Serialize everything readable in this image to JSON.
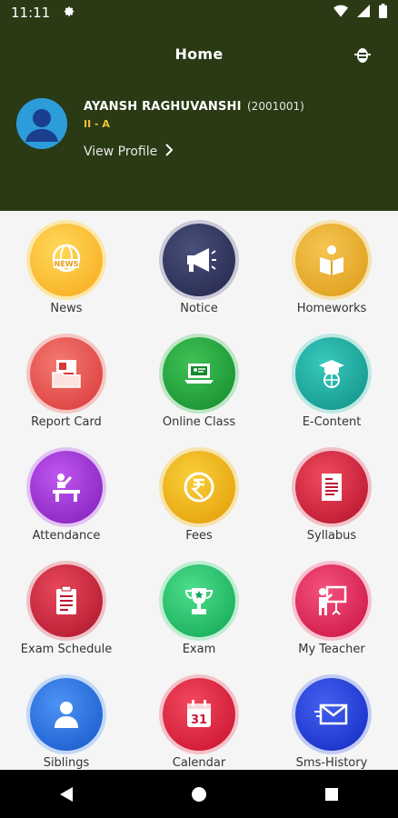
{
  "status_bar": {
    "time": "11:11"
  },
  "header": {
    "title": "Home",
    "student": {
      "name": "AYANSH RAGHUVANSHI",
      "id": "(2001001)",
      "class": "II - A",
      "view_profile": "View Profile"
    }
  },
  "menu": {
    "items": [
      {
        "label": "News",
        "icon": "news-globe-icon",
        "color": "#f7b21b"
      },
      {
        "label": "Notice",
        "icon": "megaphone-icon",
        "color": "#2a2e55"
      },
      {
        "label": "Homeworks",
        "icon": "reading-person-icon",
        "color": "#e6a419"
      },
      {
        "label": "Report Card",
        "icon": "report-card-icon",
        "color": "#e54b4b"
      },
      {
        "label": "Online Class",
        "icon": "laptop-class-icon",
        "color": "#1e9e3a"
      },
      {
        "label": "E-Content",
        "icon": "graduation-globe-icon",
        "color": "#1aa39a"
      },
      {
        "label": "Attendance",
        "icon": "teacher-desk-icon",
        "color": "#9b2fd6"
      },
      {
        "label": "Fees",
        "icon": "rupee-coin-icon",
        "color": "#f2b10e"
      },
      {
        "label": "Syllabus",
        "icon": "document-icon",
        "color": "#d81f3a"
      },
      {
        "label": "Exam Schedule",
        "icon": "clipboard-list-icon",
        "color": "#d0203a"
      },
      {
        "label": "Exam",
        "icon": "trophy-icon",
        "color": "#1ec06a"
      },
      {
        "label": "My Teacher",
        "icon": "teacher-board-icon",
        "color": "#e81e5e"
      },
      {
        "label": "Siblings",
        "icon": "person-icon",
        "color": "#1f6fe0"
      },
      {
        "label": "Calendar",
        "icon": "calendar-icon",
        "color": "#ec1f3c"
      },
      {
        "label": "Sms-History",
        "icon": "envelope-icon",
        "color": "#1a3fd8"
      }
    ],
    "calendar_day": "31"
  }
}
